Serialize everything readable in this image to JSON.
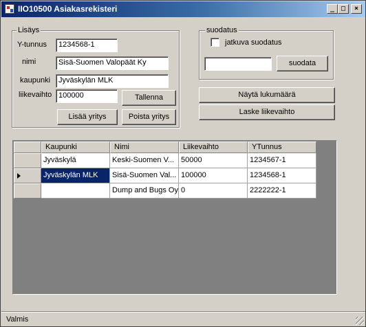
{
  "window": {
    "title": "IIO10500 Asiakasrekisteri"
  },
  "titlebar": {
    "minimize": "_",
    "maximize": "□",
    "close": "×"
  },
  "lisays": {
    "legend": "Lisäys",
    "ytunnus_label": "Y-tunnus",
    "ytunnus_value": "1234568-1",
    "nimi_label": "nimi",
    "nimi_value": "Sisä-Suomen Valopäät Ky",
    "kaupunki_label": "kaupunki",
    "kaupunki_value": "Jyväskylän MLK",
    "liikevaihto_label": "liikevaihto",
    "liikevaihto_value": "100000",
    "tallenna": "Tallenna",
    "lisaa_yritys": "Lisää yritys",
    "poista_yritys": "Poista yritys"
  },
  "suodatus": {
    "legend": "suodatus",
    "checkbox_label": "jatkuva suodatus",
    "checked": false,
    "filter_value": "",
    "button": "suodata"
  },
  "actions": {
    "nayta_lukumaara": "Näytä lukumäärä",
    "laske_liikevaihto": "Laske liikevaihto"
  },
  "grid": {
    "columns": [
      "Kaupunki",
      "Nimi",
      "Liikevaihto",
      "YTunnus"
    ],
    "rows": [
      {
        "kaupunki": "Jyväskylä",
        "nimi": "Keski-Suomen V...",
        "liikevaihto": "50000",
        "ytunnus": "1234567-1"
      },
      {
        "kaupunki": "Jyväskylän MLK",
        "nimi": "Sisä-Suomen Val...",
        "liikevaihto": "100000",
        "ytunnus": "1234568-1"
      },
      {
        "kaupunki": "",
        "nimi": "Dump and Bugs Oy",
        "liikevaihto": "0",
        "ytunnus": "2222222-1"
      }
    ],
    "current_row": 1,
    "selected_cell": {
      "row": 1,
      "column": "Kaupunki"
    }
  },
  "statusbar": {
    "text": "Valmis"
  },
  "colors": {
    "selection": "#0a246a",
    "face": "#d4d0c8",
    "grid_bg": "#808080"
  }
}
